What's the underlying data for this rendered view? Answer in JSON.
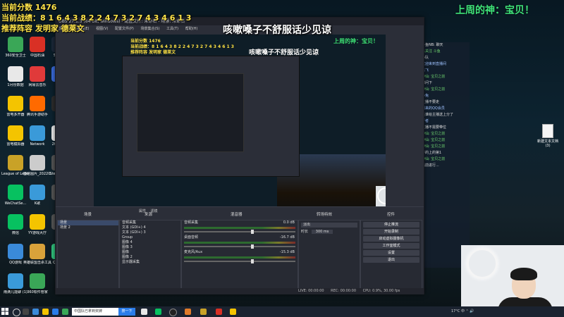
{
  "overlay": {
    "line1": "当前分数 1476",
    "line2": "当前战绩：8 1 6 4 3 8 2 2 4 7 3 2 7 4 3 4 6 1 3",
    "line3": "推荐阵容 发明家 德莱文",
    "banner": "咳嗽嗓子不舒服话少见谅",
    "weekgod": "上周的神：宝贝！"
  },
  "desktop_icons": [
    {
      "label": "360安全卫士",
      "color": "#3aa757"
    },
    {
      "label": "中国石油",
      "color": "#d93025"
    },
    {
      "label": "Steam",
      "color": "#1b2838"
    },
    {
      "label": "1月份数据",
      "color": "#e8e8e8"
    },
    {
      "label": "网易云音乐",
      "color": "#e03a3a"
    },
    {
      "label": "",
      "color": "#3a6ad9"
    },
    {
      "label": "雷电多开器",
      "color": "#f4c400"
    },
    {
      "label": "腾讯手游助手",
      "color": "#ff6a00"
    },
    {
      "label": "",
      "color": "#2c2c2c"
    },
    {
      "label": "雷电模拟器",
      "color": "#f4c400"
    },
    {
      "label": "Network",
      "color": "#3a9ad9"
    },
    {
      "label": "20211...",
      "color": "#e8e8e8"
    },
    {
      "label": "League of Legends",
      "color": "#c9a227"
    },
    {
      "label": "微信图片_2022021...",
      "color": "#cccccc"
    },
    {
      "label": "SteamSe...",
      "color": "#555555"
    },
    {
      "label": "WeChatSe...",
      "color": "#07c160"
    },
    {
      "label": "K歌",
      "color": "#3a9ad9"
    },
    {
      "label": "",
      "color": "#555555"
    },
    {
      "label": "微信",
      "color": "#07c160"
    },
    {
      "label": "YY游戏大厅",
      "color": "#f4c400"
    },
    {
      "label": "",
      "color": "#555555"
    },
    {
      "label": "QQ游戏",
      "color": "#3a8ad9"
    },
    {
      "label": "英雄联盟击杀工具",
      "color": "#d9a23a"
    },
    {
      "label": "QQ音乐",
      "color": "#31c27c"
    },
    {
      "label": "雨滴儿能聊 (1)",
      "color": "#3a9ad9"
    },
    {
      "label": "360软件管家",
      "color": "#3aa757"
    }
  ],
  "new_file": "新建文本文档 (3)",
  "obs": {
    "title": "OBS 27.1.3 (64-bit, windows) - 配置文件: 未命名 - 场景: 未命名",
    "menu": [
      "文件(F)",
      "编辑(E)",
      "视图(V)",
      "配置文件(P)",
      "场景集合(S)",
      "工具(T)",
      "帮助(H)"
    ],
    "source_bar": [
      "属性",
      "滤镜"
    ],
    "docks": {
      "scenes": {
        "title": "场景",
        "items": [
          "场景",
          "场景 2"
        ]
      },
      "sources": {
        "title": "来源",
        "items": [
          "音频采集",
          "文本 (GDI+) 4",
          "文本 (GDI+) 3",
          "Group",
          "图像 4",
          "图像 3",
          "图像",
          "图像 2",
          "显示器采集"
        ]
      },
      "mixer": {
        "title": "混音器",
        "channels": [
          {
            "name": "音频采集",
            "db": "0.0 dB"
          },
          {
            "name": "桌面音频",
            "db": "-16.7 dB"
          },
          {
            "name": "麦克风/Aux",
            "db": "-15.3 dB"
          }
        ]
      },
      "transitions": {
        "title": "转场特效",
        "type": "淡出",
        "duration_label": "时长",
        "duration": "300 ms"
      },
      "controls": {
        "title": "控件",
        "buttons": [
          "停止推流",
          "开始录制",
          "启动虚拟摄像机",
          "工作室模式",
          "设置",
          "退出"
        ]
      }
    },
    "status": {
      "live": "LIVE: 00:00:00",
      "rec": "REC: 00:00:00",
      "cpu": "CPU: 0.9%, 30.00 fps",
      "kbps": "kb/s"
    }
  },
  "chat": {
    "lines": [
      {
        "text": "斗鱼NB: 聊天",
        "cls": "w"
      },
      {
        "text": "已关注 斗鱼",
        "cls": "g"
      },
      {
        "text": "小队",
        "cls": "w"
      },
      {
        "text": "欢迎来到直播间",
        "cls": ""
      },
      {
        "text": "飞飞",
        "cls": ""
      },
      {
        "text": "神仙: 宝贝之前",
        "cls": "g"
      },
      {
        "text": "想问下",
        "cls": "w"
      },
      {
        "text": "神仙: 宝贝之前",
        "cls": "g"
      },
      {
        "text": "小兔",
        "cls": ""
      },
      {
        "text": "主播不要走",
        "cls": "w"
      },
      {
        "text": "刚来的QQ会员",
        "cls": ""
      },
      {
        "text": "是谁给主播送上分了",
        "cls": "w"
      },
      {
        "text": "折者",
        "cls": ""
      },
      {
        "text": "主播不需要带位",
        "cls": "w"
      },
      {
        "text": "神仙: 宝贝之前",
        "cls": "g"
      },
      {
        "text": "神仙: 宝贝之前",
        "cls": "g"
      },
      {
        "text": "神仙: 宝贝之前",
        "cls": "g"
      },
      {
        "text": "好的上的第1",
        "cls": "w"
      },
      {
        "text": "神仙: 宝贝之前",
        "cls": "g"
      },
      {
        "text": "当前进行...",
        "cls": "w"
      }
    ]
  },
  "taskbar": {
    "search_placeholder": "中国队已拿到奖牌",
    "search_button": "搜一下",
    "tray": "17°C  中  ⌃  🔊"
  }
}
